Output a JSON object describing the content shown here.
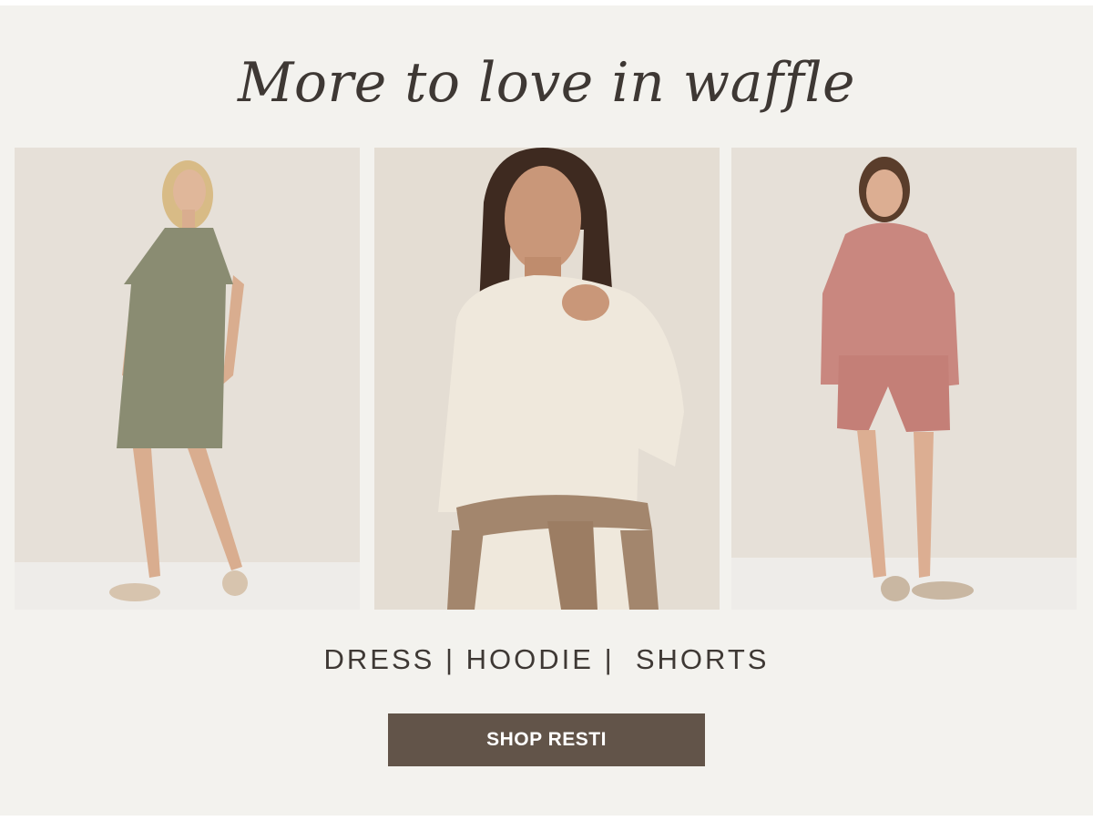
{
  "headline": "More to love in waffle",
  "products": [
    {
      "label": "DRESS",
      "image": "olive-waffle-dress-photo"
    },
    {
      "label": "HOODIE",
      "image": "cream-waffle-hoodie-photo"
    },
    {
      "label": "SHORTS",
      "image": "rose-waffle-hoodie-shorts-photo"
    }
  ],
  "separator": "|",
  "cta_label": "SHOP RESTI",
  "colors": {
    "background": "#f3f2ee",
    "text": "#3e3834",
    "button": "#625449",
    "olive": "#8a8c72",
    "cream": "#efe8dc",
    "rose": "#c9877f",
    "tan": "#a3866d"
  }
}
